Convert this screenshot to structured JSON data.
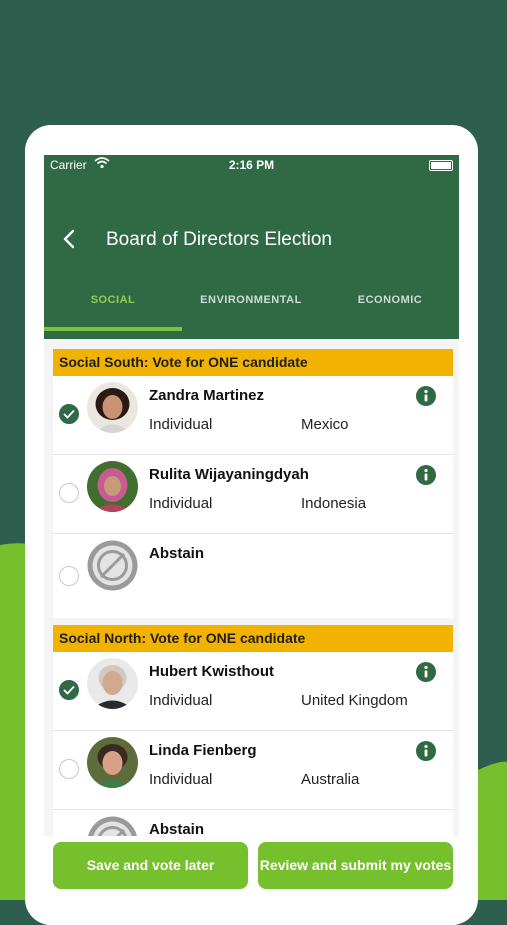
{
  "status_bar": {
    "carrier": "Carrier",
    "time": "2:16 PM"
  },
  "nav": {
    "title": "Board of Directors Election"
  },
  "tabs": [
    {
      "label": "SOCIAL",
      "active": true
    },
    {
      "label": "ENVIRONMENTAL",
      "active": false
    },
    {
      "label": "ECONOMIC",
      "active": false
    }
  ],
  "sections": [
    {
      "header": "Social South: Vote for ONE candidate",
      "candidates": [
        {
          "name": "Zandra Martinez",
          "type": "Individual",
          "country": "Mexico",
          "selected": true
        },
        {
          "name": "Rulita Wijayaningdyah",
          "type": "Individual",
          "country": "Indonesia",
          "selected": false
        },
        {
          "name": "Abstain",
          "type": "",
          "country": "",
          "selected": false
        }
      ]
    },
    {
      "header": "Social North: Vote for ONE candidate",
      "candidates": [
        {
          "name": "Hubert Kwisthout",
          "type": "Individual",
          "country": "United Kingdom",
          "selected": true
        },
        {
          "name": "Linda Fienberg",
          "type": "Individual",
          "country": "Australia",
          "selected": false
        },
        {
          "name": "Abstain",
          "type": "",
          "country": "",
          "selected": false
        }
      ]
    }
  ],
  "buttons": {
    "save_later": "Save and vote later",
    "review_submit": "Review and submit my votes"
  },
  "colors": {
    "background": "#2e5e4e",
    "accent_green": "#76bf2d",
    "header_green": "#2f6a45",
    "section_header": "#f2b200"
  }
}
